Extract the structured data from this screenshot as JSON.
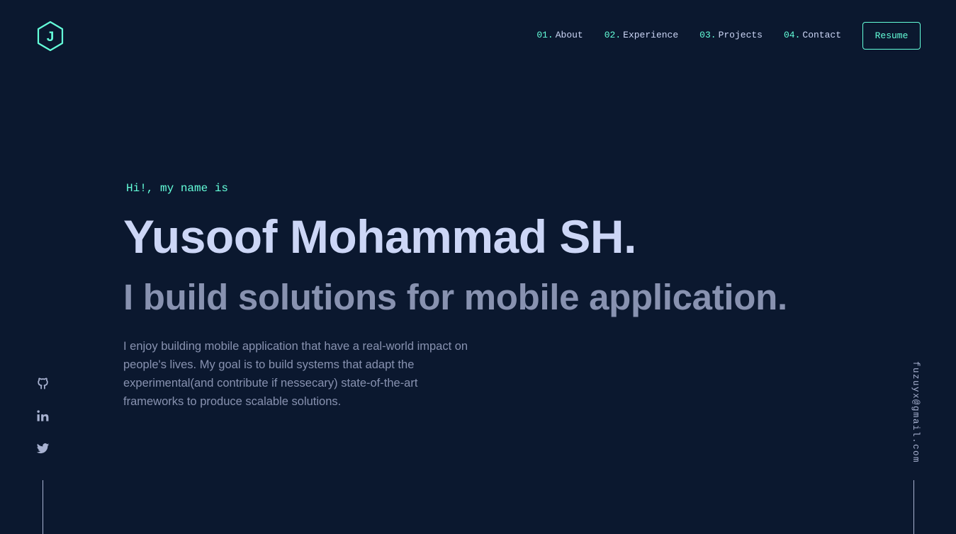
{
  "header": {
    "logo_letter": "J",
    "nav": [
      {
        "num": "01.",
        "label": "About"
      },
      {
        "num": "02.",
        "label": "Experience"
      },
      {
        "num": "03.",
        "label": "Projects"
      },
      {
        "num": "04.",
        "label": "Contact"
      }
    ],
    "resume_label": "Resume"
  },
  "hero": {
    "greeting": "Hi!, my name is",
    "name": "Yusoof Mohammad SH.",
    "tagline": "I build solutions for mobile application.",
    "intro": "I enjoy building mobile application that have a real-world impact on people's lives. My goal is to build systems that adapt the experimental(and contribute if nessecary) state-of-the-art frameworks to produce scalable solutions."
  },
  "social": {
    "icons": [
      "github-icon",
      "linkedin-icon",
      "twitter-icon"
    ]
  },
  "email": "fuzuyx@gmail.com",
  "colors": {
    "background": "#0b182f",
    "accent": "#64ffda",
    "heading": "#ccd6f6",
    "text": "#8892b0"
  }
}
